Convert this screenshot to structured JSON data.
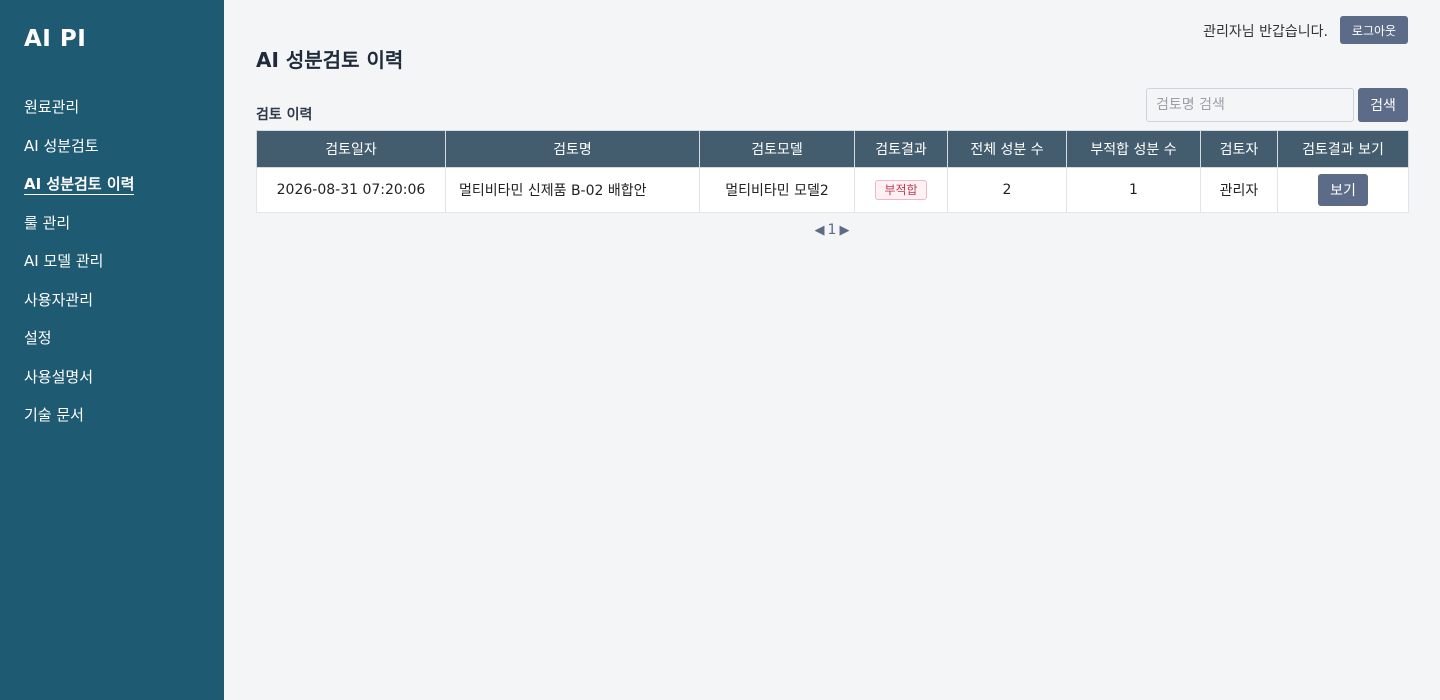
{
  "sidebar": {
    "brand": "AI PI",
    "items": [
      {
        "label": "원료관리"
      },
      {
        "label": "AI 성분검토"
      },
      {
        "label": "AI 성분검토 이력"
      },
      {
        "label": "룰 관리"
      },
      {
        "label": "AI 모델 관리"
      },
      {
        "label": "사용자관리"
      },
      {
        "label": "설정"
      },
      {
        "label": "사용설명서"
      },
      {
        "label": "기술 문서"
      }
    ],
    "active_item": "AI 성분검토 이력"
  },
  "header": {
    "greeting": "관리자님 반갑습니다.",
    "logout_label": "로그아웃"
  },
  "main": {
    "title": "AI 성분검토 이력",
    "section_title": "검토 이력",
    "search": {
      "placeholder": "검토명 검색",
      "value": "",
      "button_label": "검색"
    },
    "table": {
      "columns": [
        "검토일자",
        "검토명",
        "검토모델",
        "검토결과",
        "전체 성분 수",
        "부적합 성분 수",
        "검토자",
        "검토결과 보기"
      ],
      "rows": [
        {
          "date": "2026-08-31 07:20:06",
          "name": "멀티비타민 신제품 B-02 배합안",
          "model": "멀티비타민 모델2",
          "result": "부적합",
          "total": "2",
          "noncompliant": "1",
          "reviewer": "관리자",
          "view_label": "보기"
        }
      ]
    },
    "pagination": {
      "prev_icon": "◀",
      "current_page": "1",
      "next_icon": "▶"
    }
  },
  "colors": {
    "sidebar_bg": "#1f5a73",
    "table_header_bg": "#435d6e",
    "button_bg": "#5c6b87",
    "badge_fail": "#c23a55"
  }
}
